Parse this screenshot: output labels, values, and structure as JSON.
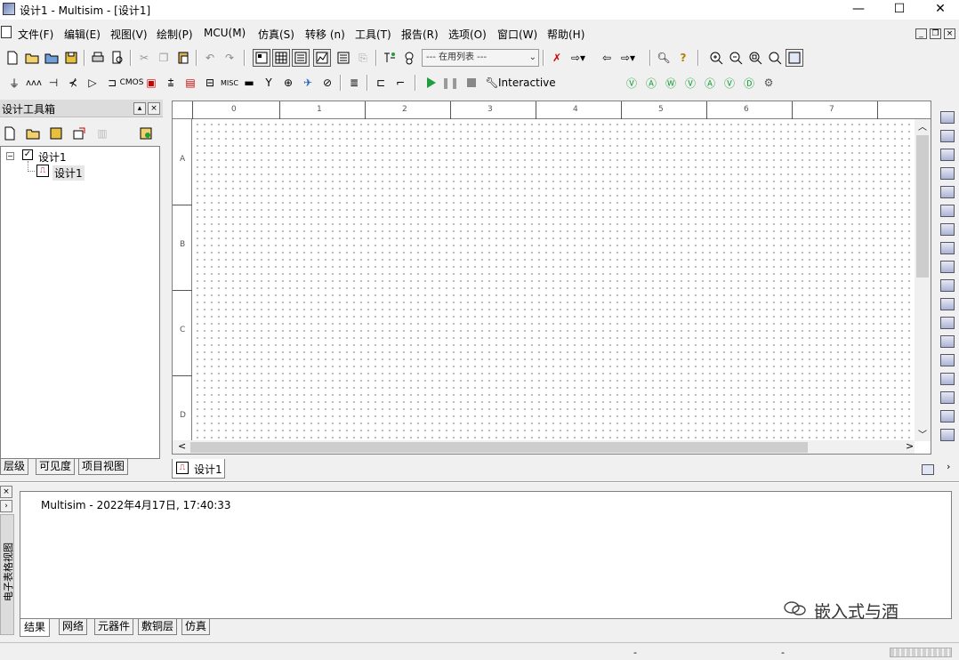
{
  "window": {
    "title": "设计1 - Multisim - [设计1]",
    "minimize": "—",
    "maximize": "☐",
    "close": "✕"
  },
  "menu": {
    "items": [
      {
        "label": "文件(F)"
      },
      {
        "label": "编辑(E)"
      },
      {
        "label": "视图(V)"
      },
      {
        "label": "绘制(P)"
      },
      {
        "label": "MCU(M)"
      },
      {
        "label": "仿真(S)"
      },
      {
        "label": "转移 (n)"
      },
      {
        "label": "工具(T)"
      },
      {
        "label": "报告(R)"
      },
      {
        "label": "选项(O)"
      },
      {
        "label": "窗口(W)"
      },
      {
        "label": "帮助(H)"
      }
    ]
  },
  "toolbar": {
    "in_use_list": "--- 在用列表 ---",
    "interactive": "Interactive"
  },
  "design_toolbox": {
    "title": "设计工具箱",
    "tree": {
      "root": "设计1",
      "child": "设计1"
    },
    "tabs": [
      "层级",
      "可见度",
      "项目视图"
    ]
  },
  "canvas": {
    "ruler_top": [
      "0",
      "1",
      "2",
      "3",
      "4",
      "5",
      "6",
      "7"
    ],
    "ruler_left": [
      "A",
      "B",
      "C",
      "D"
    ],
    "doc_tab": "设计1"
  },
  "spreadsheet": {
    "side_label": "电子表格视图",
    "log_line": "Multisim  -  2022年4月17日, 17:40:33",
    "tabs": [
      "结果",
      "网络",
      "元器件",
      "敷铜层",
      "仿真"
    ]
  },
  "watermark": "嵌入式与酒",
  "status": {
    "s1": "-",
    "s2": "-"
  },
  "colors": {
    "run_green": "#1e9e3c",
    "selection_blue": "#cfe0f4"
  }
}
